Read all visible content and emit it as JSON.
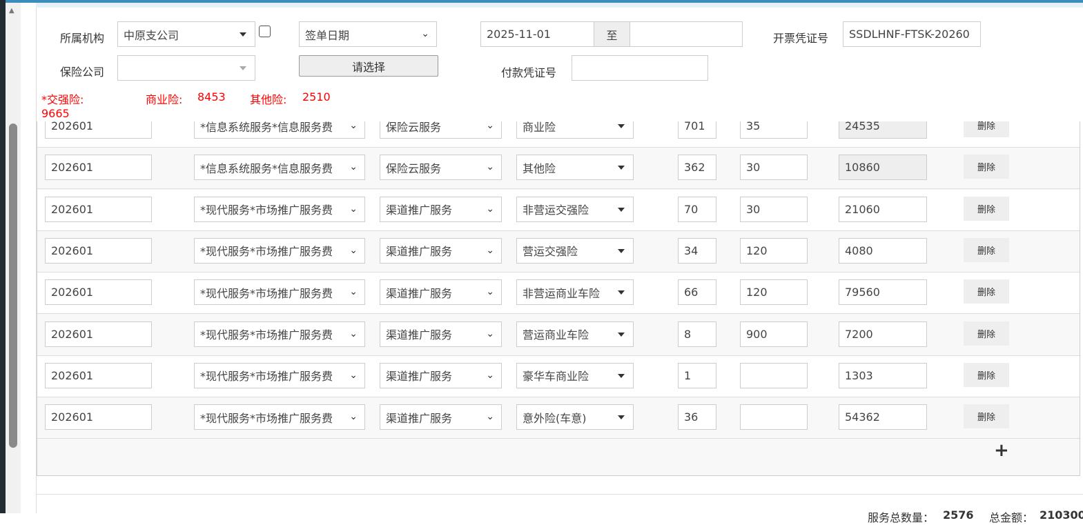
{
  "filters": {
    "org_label": "所属机构",
    "org_value": "中原支公司",
    "date_type": "签单日期",
    "date_from": "2025-11-01",
    "date_to_label": "至",
    "date_to": "",
    "invoice_label": "开票凭证号",
    "invoice_value": "SSDLHNF-FTSK-20260",
    "insurer_label": "保险公司",
    "insurer_value": "",
    "choose_button": "请选择",
    "payment_label": "付款凭证号",
    "payment_value": ""
  },
  "summary": {
    "jqx_label": "*交强险:",
    "jqx_value": "9665",
    "syx_label": "商业险:",
    "syx_value": "8453",
    "qtx_label": "其他险:",
    "qtx_value": "2510"
  },
  "rows": [
    {
      "period": "202601",
      "item": "*信息系统服务*信息服务费",
      "service": "保险云服务",
      "type": "商业险",
      "qty": "701",
      "price": "35",
      "amount": "24535",
      "readonly": true,
      "del": "删除"
    },
    {
      "period": "202601",
      "item": "*信息系统服务*信息服务费",
      "service": "保险云服务",
      "type": "其他险",
      "qty": "362",
      "price": "30",
      "amount": "10860",
      "readonly": true,
      "del": "删除"
    },
    {
      "period": "202601",
      "item": "*现代服务*市场推广服务费",
      "service": "渠道推广服务",
      "type": "非营运交强险",
      "qty": "70",
      "price": "30",
      "amount": "21060",
      "readonly": false,
      "del": "删除"
    },
    {
      "period": "202601",
      "item": "*现代服务*市场推广服务费",
      "service": "渠道推广服务",
      "type": "营运交强险",
      "qty": "34",
      "price": "120",
      "amount": "4080",
      "readonly": false,
      "del": "删除"
    },
    {
      "period": "202601",
      "item": "*现代服务*市场推广服务费",
      "service": "渠道推广服务",
      "type": "非营运商业车险",
      "qty": "66",
      "price": "120",
      "amount": "79560",
      "readonly": false,
      "del": "删除"
    },
    {
      "period": "202601",
      "item": "*现代服务*市场推广服务费",
      "service": "渠道推广服务",
      "type": "营运商业车险",
      "qty": "8",
      "price": "900",
      "amount": "7200",
      "readonly": false,
      "del": "删除"
    },
    {
      "period": "202601",
      "item": "*现代服务*市场推广服务费",
      "service": "渠道推广服务",
      "type": "豪华车商业险",
      "qty": "1",
      "price": "",
      "amount": "1303",
      "readonly": false,
      "del": "删除"
    },
    {
      "period": "202601",
      "item": "*现代服务*市场推广服务费",
      "service": "渠道推广服务",
      "type": "意外险(车意)",
      "qty": "36",
      "price": "",
      "amount": "54362",
      "readonly": false,
      "del": "删除"
    }
  ],
  "add_button": "+",
  "footer": {
    "count_label": "服务总数量：",
    "count_value": "2576",
    "total_label": "总金额：",
    "total_value": "210300"
  }
}
